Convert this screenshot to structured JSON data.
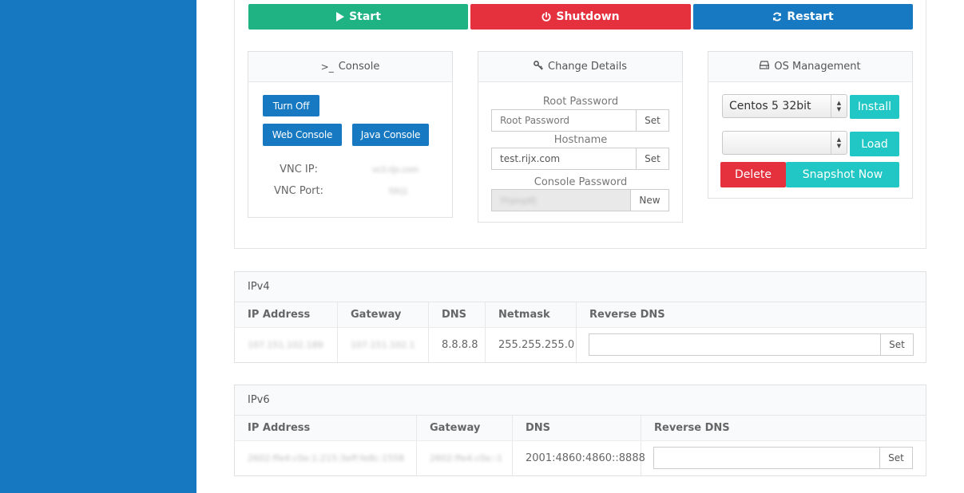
{
  "power": {
    "start_label": "Start",
    "shutdown_label": "Shutdown",
    "restart_label": "Restart",
    "colors": {
      "start": "#1fb384",
      "shutdown": "#e5303e",
      "restart": "#1779c2"
    }
  },
  "console": {
    "title": "Console",
    "turn_off_label": "Turn Off",
    "web_console_label": "Web Console",
    "java_console_label": "Java Console",
    "vnc_ip_label": "VNC IP:",
    "vnc_ip_value": "vc3.rijx.com",
    "vnc_port_label": "VNC Port:",
    "vnc_port_value": "5911"
  },
  "change_details": {
    "title": "Change Details",
    "root_password_label": "Root Password",
    "root_password_placeholder": "Root Password",
    "root_set_label": "Set",
    "hostname_label": "Hostname",
    "hostname_value": "test.rijx.com",
    "hostname_set_label": "Set",
    "console_password_label": "Console Password",
    "console_password_value": "Ytqoqdfj",
    "new_label": "New"
  },
  "os_management": {
    "title": "OS Management",
    "os_selected": "Centos 5 32bit",
    "install_label": "Install",
    "snapshot_selected": "",
    "load_label": "Load",
    "delete_label": "Delete",
    "snapshot_now_label": "Snapshot Now"
  },
  "ipv4": {
    "title": "IPv4",
    "headers": [
      "IP Address",
      "Gateway",
      "DNS",
      "Netmask",
      "Reverse DNS"
    ],
    "row": {
      "ip": "107.151.102.189",
      "gateway": "107.151.102.1",
      "dns": "8.8.8.8",
      "netmask": "255.255.255.0",
      "rdns_value": "",
      "set_label": "Set"
    }
  },
  "ipv6": {
    "title": "IPv6",
    "headers": [
      "IP Address",
      "Gateway",
      "DNS",
      "Reverse DNS"
    ],
    "row": {
      "ip": "2602:ffe4:c0e:1:215:3eff:fe8c:1558",
      "gateway": "2602:ffe4:c0e::1",
      "dns": "2001:4860:4860::8888",
      "rdns_value": "",
      "set_label": "Set"
    }
  }
}
